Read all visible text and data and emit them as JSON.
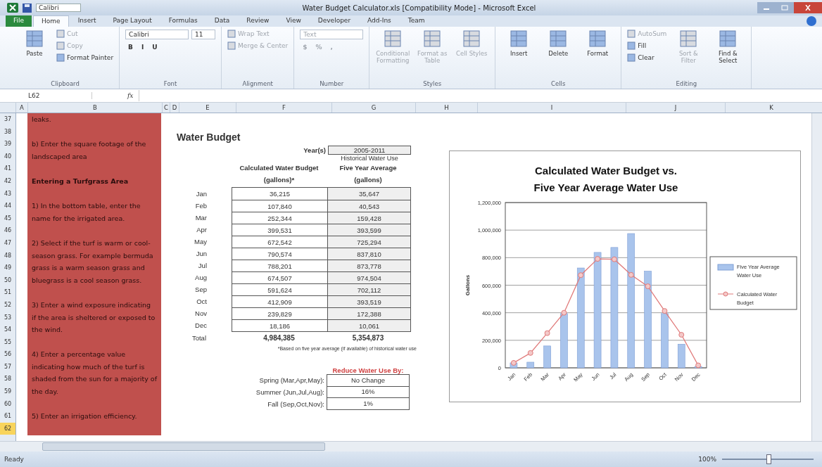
{
  "window": {
    "title": "Water Budget Calculator.xls [Compatibility Mode] - Microsoft Excel",
    "quick_font": "Calibri"
  },
  "tabs": [
    {
      "label": "File",
      "kind": "file",
      "selected": false
    },
    {
      "label": "Home",
      "kind": "tab",
      "selected": true
    },
    {
      "label": "Insert",
      "kind": "tab",
      "selected": false
    },
    {
      "label": "Page Layout",
      "kind": "tab",
      "selected": false
    },
    {
      "label": "Formulas",
      "kind": "tab",
      "selected": false
    },
    {
      "label": "Data",
      "kind": "tab",
      "selected": false
    },
    {
      "label": "Review",
      "kind": "tab",
      "selected": false
    },
    {
      "label": "View",
      "kind": "tab",
      "selected": false
    },
    {
      "label": "Developer",
      "kind": "tab",
      "selected": false
    },
    {
      "label": "Add-Ins",
      "kind": "tab",
      "selected": false
    },
    {
      "label": "Team",
      "kind": "tab",
      "selected": false
    }
  ],
  "ribbon": [
    {
      "label": "Clipboard",
      "columns": [
        [
          {
            "label": "Paste",
            "kind": "large",
            "disabled": false
          }
        ],
        [
          {
            "label": "Cut",
            "kind": "small",
            "disabled": true
          },
          {
            "label": "Copy",
            "kind": "small",
            "disabled": true
          },
          {
            "label": "Format Painter",
            "kind": "small",
            "disabled": false
          }
        ]
      ]
    },
    {
      "label": "Font",
      "columns": [
        [
          [
            {
              "label": "Calibri",
              "kind": "field",
              "disabled": false
            },
            {
              "label": "11",
              "kind": "field",
              "disabled": false
            }
          ],
          [
            {
              "label": "B",
              "kind": "glyph",
              "disabled": false
            },
            {
              "label": "I",
              "kind": "glyph",
              "disabled": false
            },
            {
              "label": "U",
              "kind": "glyph",
              "disabled": false
            }
          ]
        ]
      ]
    },
    {
      "label": "Alignment",
      "columns": [
        [
          {
            "label": "Wrap Text",
            "kind": "small",
            "disabled": true
          },
          {
            "label": "Merge & Center",
            "kind": "small",
            "disabled": true
          }
        ]
      ]
    },
    {
      "label": "Number",
      "columns": [
        [
          [
            {
              "label": "Text",
              "kind": "field",
              "disabled": true
            }
          ],
          [
            {
              "label": "$",
              "kind": "glyph",
              "disabled": true
            },
            {
              "label": "%",
              "kind": "glyph",
              "disabled": true
            },
            {
              "label": ",",
              "kind": "glyph",
              "disabled": true
            }
          ]
        ]
      ]
    },
    {
      "label": "Styles",
      "columns": [
        [
          {
            "label": "Conditional Formatting",
            "kind": "large",
            "disabled": true
          }
        ],
        [
          {
            "label": "Format as Table",
            "kind": "large",
            "disabled": true
          }
        ],
        [
          {
            "label": "Cell Styles",
            "kind": "large",
            "disabled": true
          }
        ]
      ]
    },
    {
      "label": "Cells",
      "columns": [
        [
          {
            "label": "Insert",
            "kind": "large",
            "disabled": false
          }
        ],
        [
          {
            "label": "Delete",
            "kind": "large",
            "disabled": false
          }
        ],
        [
          {
            "label": "Format",
            "kind": "large",
            "disabled": false
          }
        ]
      ]
    },
    {
      "label": "Editing",
      "columns": [
        [
          {
            "label": "AutoSum",
            "kind": "small",
            "disabled": true
          },
          {
            "label": "Fill",
            "kind": "small",
            "disabled": false
          },
          {
            "label": "Clear",
            "kind": "small",
            "disabled": false
          }
        ],
        [
          {
            "label": "Sort & Filter",
            "kind": "large",
            "disabled": true
          }
        ],
        [
          {
            "label": "Find & Select",
            "kind": "large",
            "disabled": false
          }
        ]
      ]
    }
  ],
  "formula_bar": {
    "name_box": "L62",
    "fx": "fx"
  },
  "columns": [
    "A",
    "B",
    "C",
    "D",
    "E",
    "F",
    "G",
    "H",
    "I",
    "J",
    "K"
  ],
  "rows": [
    {
      "label": "37",
      "selected": false
    },
    {
      "label": "38",
      "selected": false
    },
    {
      "label": "39",
      "selected": false
    },
    {
      "label": "40",
      "selected": false
    },
    {
      "label": "41",
      "selected": false
    },
    {
      "label": "42",
      "selected": false
    },
    {
      "label": "43",
      "selected": false
    },
    {
      "label": "44",
      "selected": false
    },
    {
      "label": "45",
      "selected": false
    },
    {
      "label": "46",
      "selected": false
    },
    {
      "label": "47",
      "selected": false
    },
    {
      "label": "48",
      "selected": false
    },
    {
      "label": "49",
      "selected": false
    },
    {
      "label": "50",
      "selected": false
    },
    {
      "label": "51",
      "selected": false
    },
    {
      "label": "52",
      "selected": false
    },
    {
      "label": "53",
      "selected": false
    },
    {
      "label": "54",
      "selected": false
    },
    {
      "label": "55",
      "selected": false
    },
    {
      "label": "56",
      "selected": false
    },
    {
      "label": "57",
      "selected": false
    },
    {
      "label": "58",
      "selected": false
    },
    {
      "label": "59",
      "selected": false
    },
    {
      "label": "60",
      "selected": false
    },
    {
      "label": "61",
      "selected": false
    },
    {
      "label": "62",
      "selected": true
    }
  ],
  "instructions": [
    {
      "text": "leaks.",
      "bold": false
    },
    {
      "text": "b) Enter the square footage of the landscaped area",
      "bold": false
    },
    {
      "text": "Entering a Turfgrass Area",
      "bold": true
    },
    {
      "text": "1) In the bottom table, enter the name for the irrigated area.",
      "bold": false
    },
    {
      "text": "2) Select if the turf is warm or cool-season grass.  For example bermuda grass is a warm season grass and bluegrass is a cool season grass.",
      "bold": false
    },
    {
      "text": "3) Enter a wind exposure indicating if the area is sheltered or exposed to the wind.",
      "bold": false
    },
    {
      "text": "4) Enter a percentage value indicating how much of the turf is shaded from the sun for a majority of the day.",
      "bold": false
    },
    {
      "text": "5) Enter an irrigation efficiency.",
      "bold": false
    }
  ],
  "budget": {
    "title": "Water Budget",
    "year_label": "Year(s)",
    "year_value": "2005-2011",
    "historical_label": "Historical Water Use",
    "headers": [
      "Calculated Water Budget (gallons)*",
      "Five Year Average (gallons)"
    ],
    "rows": [
      {
        "month": "Jan",
        "calculated": "36,215",
        "average": "35,647"
      },
      {
        "month": "Feb",
        "calculated": "107,840",
        "average": "40,543"
      },
      {
        "month": "Mar",
        "calculated": "252,344",
        "average": "159,428"
      },
      {
        "month": "Apr",
        "calculated": "399,531",
        "average": "393,599"
      },
      {
        "month": "May",
        "calculated": "672,542",
        "average": "725,294"
      },
      {
        "month": "Jun",
        "calculated": "790,574",
        "average": "837,810"
      },
      {
        "month": "Jul",
        "calculated": "788,201",
        "average": "873,778"
      },
      {
        "month": "Aug",
        "calculated": "674,507",
        "average": "974,504"
      },
      {
        "month": "Sep",
        "calculated": "591,624",
        "average": "702,112"
      },
      {
        "month": "Oct",
        "calculated": "412,909",
        "average": "393,519"
      },
      {
        "month": "Nov",
        "calculated": "239,829",
        "average": "172,388"
      },
      {
        "month": "Dec",
        "calculated": "18,186",
        "average": "10,061"
      }
    ],
    "total_label": "Total",
    "totals": [
      "4,984,385",
      "5,354,873"
    ],
    "footnote": "*Based on five year average (if available) of historical water use"
  },
  "reduce": {
    "title": "Reduce Water Use By:",
    "rows": [
      {
        "season": "Spring (Mar,Apr,May):",
        "value": "No Change"
      },
      {
        "season": "Summer (Jun,Jul,Aug):",
        "value": "16%"
      },
      {
        "season": "Fall (Sep,Oct,Nov):",
        "value": "1%"
      }
    ]
  },
  "chart": {
    "chart_data": {
      "type": "bar",
      "title": "Calculated Water Budget vs. Five Year Average Water Use",
      "ylabel": "Gallons",
      "categories": [
        "Jan",
        "Feb",
        "Mar",
        "Apr",
        "May",
        "Jun",
        "Jul",
        "Aug",
        "Sep",
        "Oct",
        "Nov",
        "Dec"
      ],
      "grid": true,
      "legend": true,
      "series": [
        {
          "name": "Five Year Average Water Use",
          "type": "bar",
          "color": "#a9c4ec",
          "values": [
            36000,
            41000,
            159000,
            394000,
            725000,
            838000,
            874000,
            975000,
            702000,
            394000,
            172000,
            10000
          ]
        },
        {
          "name": "Calculated Water Budget",
          "type": "line",
          "marker": true,
          "color": "#e07a7a",
          "values": [
            36000,
            108000,
            252000,
            400000,
            673000,
            791000,
            788000,
            675000,
            592000,
            413000,
            240000,
            18000
          ]
        }
      ],
      "ylim": [
        0,
        1200000
      ],
      "yticks": [
        {
          "value": 0,
          "label": "0"
        },
        {
          "value": 200000,
          "label": "200,000"
        },
        {
          "value": 400000,
          "label": "400,000"
        },
        {
          "value": 600000,
          "label": "600,000"
        },
        {
          "value": 800000,
          "label": "800,000"
        },
        {
          "value": 1000000,
          "label": "1,000,000"
        },
        {
          "value": 1200000,
          "label": "1,200,000"
        }
      ]
    }
  },
  "status_bar": {
    "ready": "Ready",
    "zoom": "100%",
    "zoom_level": {
      "level": 0.5
    }
  }
}
